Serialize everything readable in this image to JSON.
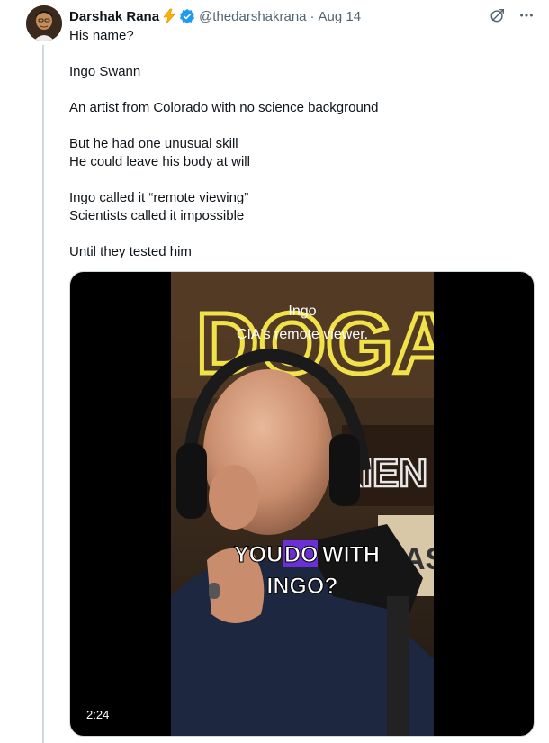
{
  "tweet": {
    "author_name": "Darshak Rana",
    "handle": "@thedarshakrana",
    "separator": "·",
    "date": "Aug 14",
    "lines": [
      "His name?",
      "",
      "Ingo Swann",
      "",
      "An artist from Colorado with no science background",
      "",
      "But he had one unusual skill",
      "He could leave his body at will",
      "",
      "Ingo called it “remote viewing”",
      "Scientists called it impossible",
      "",
      "Until they tested him"
    ]
  },
  "video": {
    "top_caption_1": "Ingo",
    "top_caption_2": "CIA's remote viewer.",
    "subtitle_word_1": "YOU",
    "subtitle_word_2": "DO",
    "subtitle_word_3": "WITH",
    "subtitle_line_2": "INGO?",
    "duration": "2:24"
  },
  "icons": {
    "verified": "verified-badge-icon",
    "bolt": "lightning-bolt-emoji",
    "grok": "grok-icon",
    "more": "more-icon"
  },
  "colors": {
    "accent": "#1d9bf0",
    "subtle_text": "#536471",
    "thread_line": "#cfd9de",
    "subtitle_highlight": "#6b2fd6"
  }
}
